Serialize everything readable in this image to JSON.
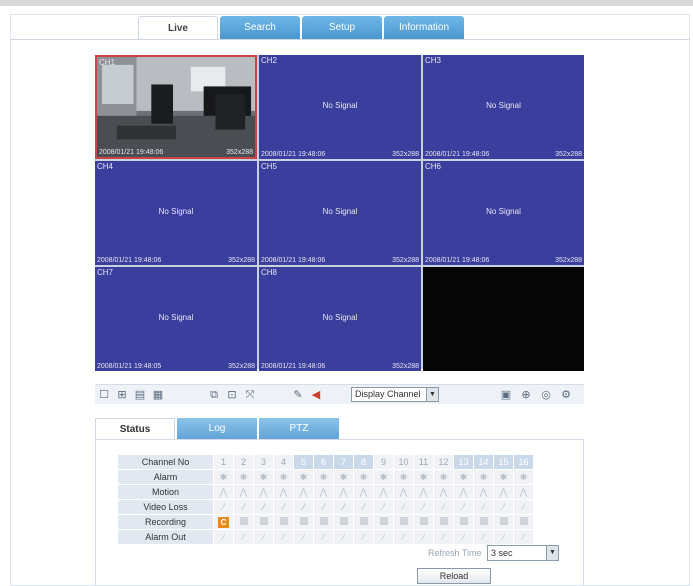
{
  "nav": {
    "tabs": [
      {
        "label": "Live"
      },
      {
        "label": "Search"
      },
      {
        "label": "Setup"
      },
      {
        "label": "Information"
      }
    ]
  },
  "channels": [
    {
      "label": "CH1",
      "status": "",
      "timestamp": "2008/01/21 19:48:06",
      "resolution": "352x288"
    },
    {
      "label": "CH2",
      "status": "No Signal",
      "timestamp": "2008/01/21 19:48:06",
      "resolution": "352x288"
    },
    {
      "label": "CH3",
      "status": "No Signal",
      "timestamp": "2008/01/21 19:48:06",
      "resolution": "352x288"
    },
    {
      "label": "CH4",
      "status": "No Signal",
      "timestamp": "2008/01/21 19:48:06",
      "resolution": "352x288"
    },
    {
      "label": "CH5",
      "status": "No Signal",
      "timestamp": "2008/01/21 19:48:06",
      "resolution": "352x288"
    },
    {
      "label": "CH6",
      "status": "No Signal",
      "timestamp": "2008/01/21 19:48:06",
      "resolution": "352x288"
    },
    {
      "label": "CH7",
      "status": "No Signal",
      "timestamp": "2008/01/21 19:48:05",
      "resolution": "352x288"
    },
    {
      "label": "CH8",
      "status": "No Signal",
      "timestamp": "2008/01/21 19:48:06",
      "resolution": "352x288"
    }
  ],
  "toolbar": {
    "display_select": "Display Channel"
  },
  "status_tabs": [
    {
      "label": "Status"
    },
    {
      "label": "Log"
    },
    {
      "label": "PTZ"
    }
  ],
  "status_table": {
    "header_label": "Channel No",
    "channel_numbers": [
      "1",
      "2",
      "3",
      "4",
      "5",
      "6",
      "7",
      "8",
      "9",
      "10",
      "11",
      "12",
      "13",
      "14",
      "15",
      "16"
    ],
    "rows": [
      "Alarm",
      "Motion",
      "Video Loss",
      "Recording",
      "Alarm Out"
    ]
  },
  "refresh": {
    "label": "Refresh Time",
    "value": "3 sec"
  },
  "reload_label": "Reload"
}
